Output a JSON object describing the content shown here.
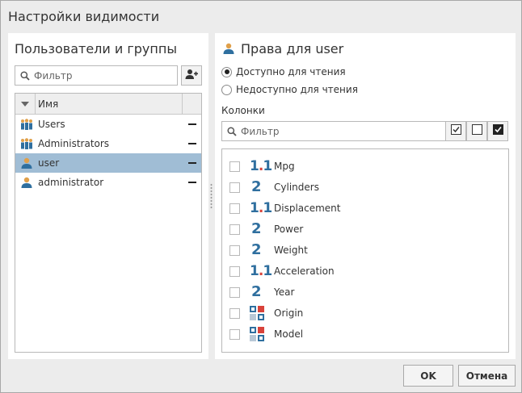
{
  "dialog": {
    "title": "Настройки видимости"
  },
  "left_panel": {
    "title": "Пользователи и группы",
    "filter_placeholder": "Фильтр",
    "table": {
      "column_header": "Имя",
      "rows": [
        {
          "name": "Users",
          "kind": "group-icon",
          "selected": false
        },
        {
          "name": "Administrators",
          "kind": "group-icon",
          "selected": false
        },
        {
          "name": "user",
          "kind": "user-icon",
          "selected": true
        },
        {
          "name": "administrator",
          "kind": "user-icon",
          "selected": false
        }
      ]
    }
  },
  "right_panel": {
    "title": "Права для user",
    "radio_readable": "Доступно для чтения",
    "radio_not_readable": "Недоступно для чтения",
    "selected_radio": "readable",
    "columns_label": "Колонки",
    "filter_placeholder": "Фильтр",
    "columns": [
      {
        "name": "Mpg",
        "type": "float"
      },
      {
        "name": "Cylinders",
        "type": "int"
      },
      {
        "name": "Displacement",
        "type": "float"
      },
      {
        "name": "Power",
        "type": "int"
      },
      {
        "name": "Weight",
        "type": "int"
      },
      {
        "name": "Acceleration",
        "type": "float"
      },
      {
        "name": "Year",
        "type": "int"
      },
      {
        "name": "Origin",
        "type": "category"
      },
      {
        "name": "Model",
        "type": "category"
      }
    ],
    "type_labels": {
      "float_main": "1",
      "float_dot": ".",
      "float_tail": "1",
      "int": "2"
    }
  },
  "footer": {
    "ok": "OK",
    "cancel": "Отмена"
  },
  "colors": {
    "selection": "#a0bdd5",
    "accent_blue": "#2f6f9f",
    "accent_red": "#d9423a",
    "user_orange": "#e0a04a"
  }
}
